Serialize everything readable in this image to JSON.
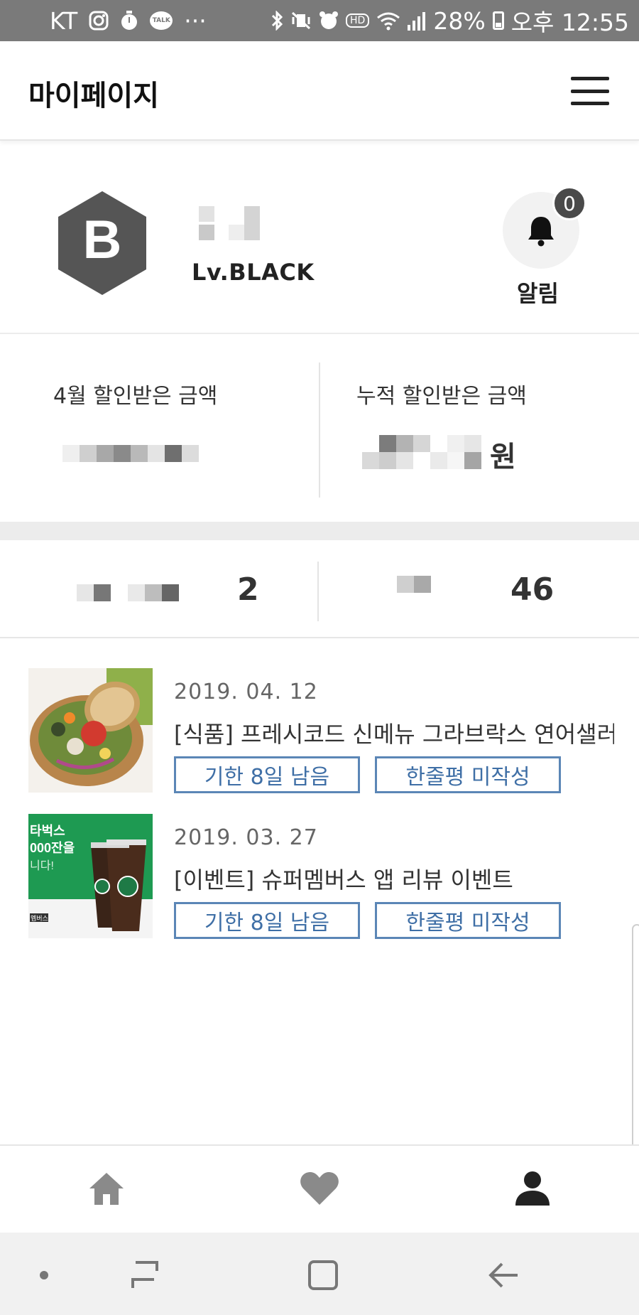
{
  "status_bar": {
    "carrier": "KT",
    "talk_badge": "TALK",
    "hd_badge": "HD",
    "battery": "28%",
    "time": "오후 12:55",
    "dots": "···"
  },
  "header": {
    "title": "마이페이지"
  },
  "profile": {
    "level_letter": "B",
    "level": "Lv.BLACK",
    "notification_count": "0",
    "notification_label": "알림"
  },
  "savings": {
    "monthly_label": "4월 할인받은 금액",
    "total_label": "누적 할인받은 금액",
    "total_unit": "원"
  },
  "stats": {
    "left_value": "2",
    "right_value": "46"
  },
  "list": [
    {
      "date": "2019. 04. 12",
      "title": "[식품] 프레시코드 신메뉴 그라브락스 연어샐러드",
      "deadline": "기한 8일 남음",
      "review": "한줄평 미작성",
      "thumb": "salad-photo"
    },
    {
      "date": "2019. 03. 27",
      "title": "[이벤트] 슈퍼멤버스 앱 리뷰 이벤트",
      "deadline": "기한 8일 남음",
      "review": "한줄평 미작성",
      "thumb": "starbucks-banner",
      "thumb_text": [
        "타벅스",
        "000잔을",
        "니다!"
      ],
      "thumb_brand": "멤버스"
    }
  ],
  "tabs": [
    {
      "icon": "home-icon"
    },
    {
      "icon": "heart-icon"
    },
    {
      "icon": "person-icon",
      "active": true
    }
  ],
  "colors": {
    "accent_blue": "#5b86b6",
    "status_bar": "#7a7a7a",
    "badge_gray": "#4a4a4a"
  }
}
